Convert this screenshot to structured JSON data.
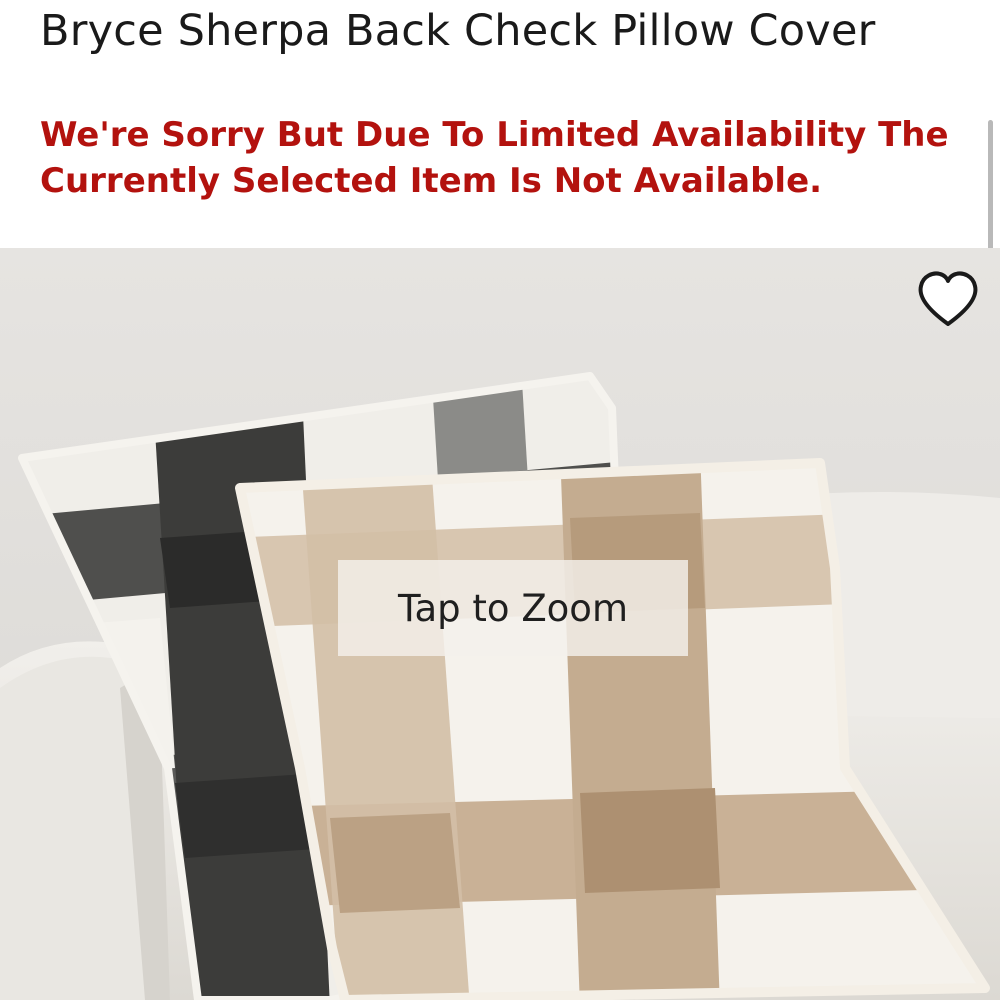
{
  "product": {
    "title": "Bryce Sherpa Back Check Pillow Cover",
    "availability_notice": "We're Sorry But Due To Limited Availability The Currently Selected Item Is Not Available."
  },
  "gallery": {
    "zoom_label": "Tap to Zoom",
    "wishlist_icon": "heart-outline-icon",
    "image_subject": "product-photo-check-pillows"
  },
  "colors": {
    "notice_red": "#b3120e",
    "title_text": "#1a1a1a"
  }
}
